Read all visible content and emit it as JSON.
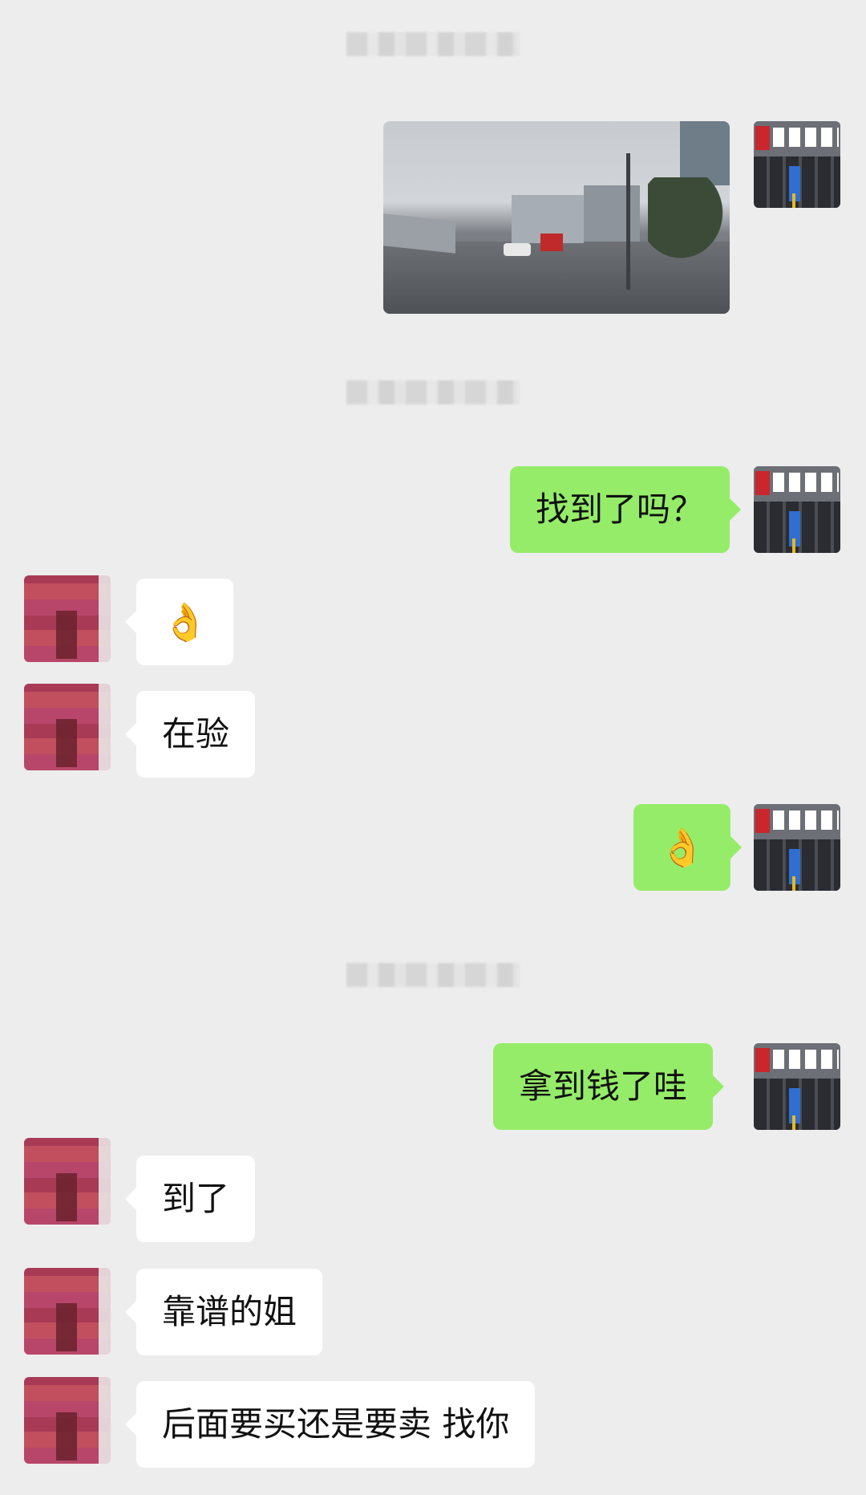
{
  "chat": {
    "messages": [
      {
        "side": "me",
        "type": "image"
      },
      {
        "side": "me",
        "type": "text",
        "text": "找到了吗？"
      },
      {
        "side": "them",
        "type": "text",
        "text": "👌"
      },
      {
        "side": "them",
        "type": "text",
        "text": "在验"
      },
      {
        "side": "me",
        "type": "text",
        "text": "👌"
      },
      {
        "side": "me",
        "type": "text",
        "text": "拿到钱了哇"
      },
      {
        "side": "them",
        "type": "text",
        "text": "到了"
      },
      {
        "side": "them",
        "type": "text",
        "text": "靠谱的姐"
      },
      {
        "side": "them",
        "type": "text",
        "text": "后面要买还是要卖 找你"
      }
    ]
  },
  "colors": {
    "background": "#ededed",
    "my_bubble": "#95ec69",
    "their_bubble": "#ffffff"
  },
  "icons": {
    "ok_hand": "ok-hand-emoji"
  }
}
